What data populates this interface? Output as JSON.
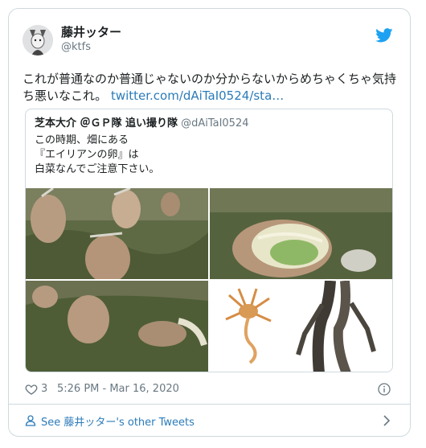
{
  "author": {
    "display_name": "藤井ッター",
    "handle": "@ktfs"
  },
  "tweet": {
    "text": "これが普通なのか普通じゃないのか分からないからめちゃくちゃ気持ち悪いなこれ。",
    "link_text": "twitter.com/dAiTaI0524/sta…"
  },
  "quoted": {
    "name": "芝本大介 ＠ＧＰ隊 追い撮り隊",
    "handle": "@dAiTaI0524",
    "lines": [
      "この時期、畑にある",
      "『エイリアンの卵』は",
      "白菜なんでご注意下さい。"
    ]
  },
  "meta": {
    "like_count": "3",
    "timestamp": "5:26 PM - Mar 16, 2020"
  },
  "see_more": {
    "label": "See 藤井ッター's other Tweets"
  },
  "icons": {
    "bird": "twitter-bird-icon",
    "heart": "heart-icon",
    "info": "info-icon",
    "person": "person-icon",
    "chevron": "chevron-right-icon"
  },
  "colors": {
    "brand": "#1da1f2",
    "link": "#2b7bb9",
    "muted": "#697882",
    "border": "#cfd9de"
  }
}
